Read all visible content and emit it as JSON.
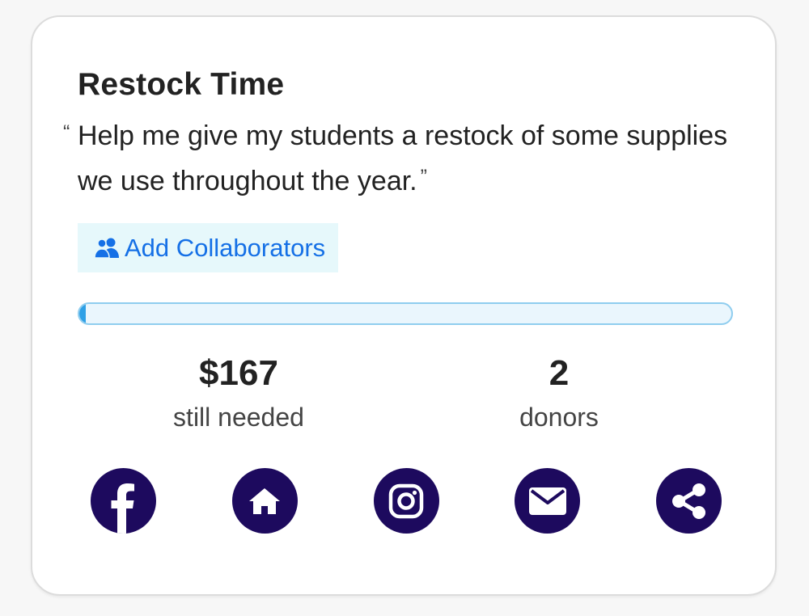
{
  "project": {
    "title": "Restock Time",
    "quote_open": "“",
    "quote_text": "Help me give my students a restock of some supplies we use throughout the year.",
    "quote_close": "”"
  },
  "collaborators": {
    "button_label": "Add Collaborators",
    "icon": "users-icon"
  },
  "progress": {
    "percent_funded": 1
  },
  "stats": {
    "needed_value": "$167",
    "needed_label": "still needed",
    "donors_value": "2",
    "donors_label": "donors"
  },
  "share": {
    "icons": [
      "facebook-icon",
      "nextdoor-icon",
      "instagram-icon",
      "email-icon",
      "share-icon"
    ]
  },
  "colors": {
    "accent_link": "#1570e6",
    "button_bg": "#e6f8fb",
    "social_bg": "#1d0a5e",
    "progress_fill": "#2ea0e6",
    "progress_border": "#8fcdef"
  }
}
